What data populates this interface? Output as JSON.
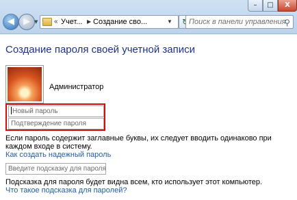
{
  "window_controls": {
    "minimize": "–",
    "maximize": "□",
    "close": "X"
  },
  "nav": {
    "back_icon": "back-arrow-icon",
    "back_glyph": "◀",
    "forward_glyph": "▶",
    "dropdown_glyph": "▼",
    "breadcrumb_root_glyph": "«",
    "breadcrumbs": [
      "Учет...",
      "Создание сво..."
    ],
    "crumb_separator": "▶",
    "address_chevron": "▼",
    "refresh_glyph": "↻"
  },
  "search": {
    "placeholder": "Поиск в панели управления",
    "icon": "search-icon",
    "glyph": "⚲"
  },
  "page": {
    "title": "Создание пароля своей учетной записи",
    "account_name": "Администратор",
    "new_password_placeholder": "Новый пароль",
    "confirm_password_placeholder": "Подтверждение пароля",
    "caps_note": "Если пароль содержит заглавные буквы, их следует вводить одинаково при каждом входе в систему.",
    "strong_password_link": "Как создать надежный пароль",
    "hint_placeholder": "Введите подсказку для пароля",
    "hint_note": "Подсказка для пароля будет видна всем, кто использует этот компьютер.",
    "hint_help_link": "Что такое подсказка для паролей?"
  },
  "colors": {
    "title": "#1e3287",
    "link": "#1f5ca8",
    "highlight_box": "#d40c0c"
  }
}
